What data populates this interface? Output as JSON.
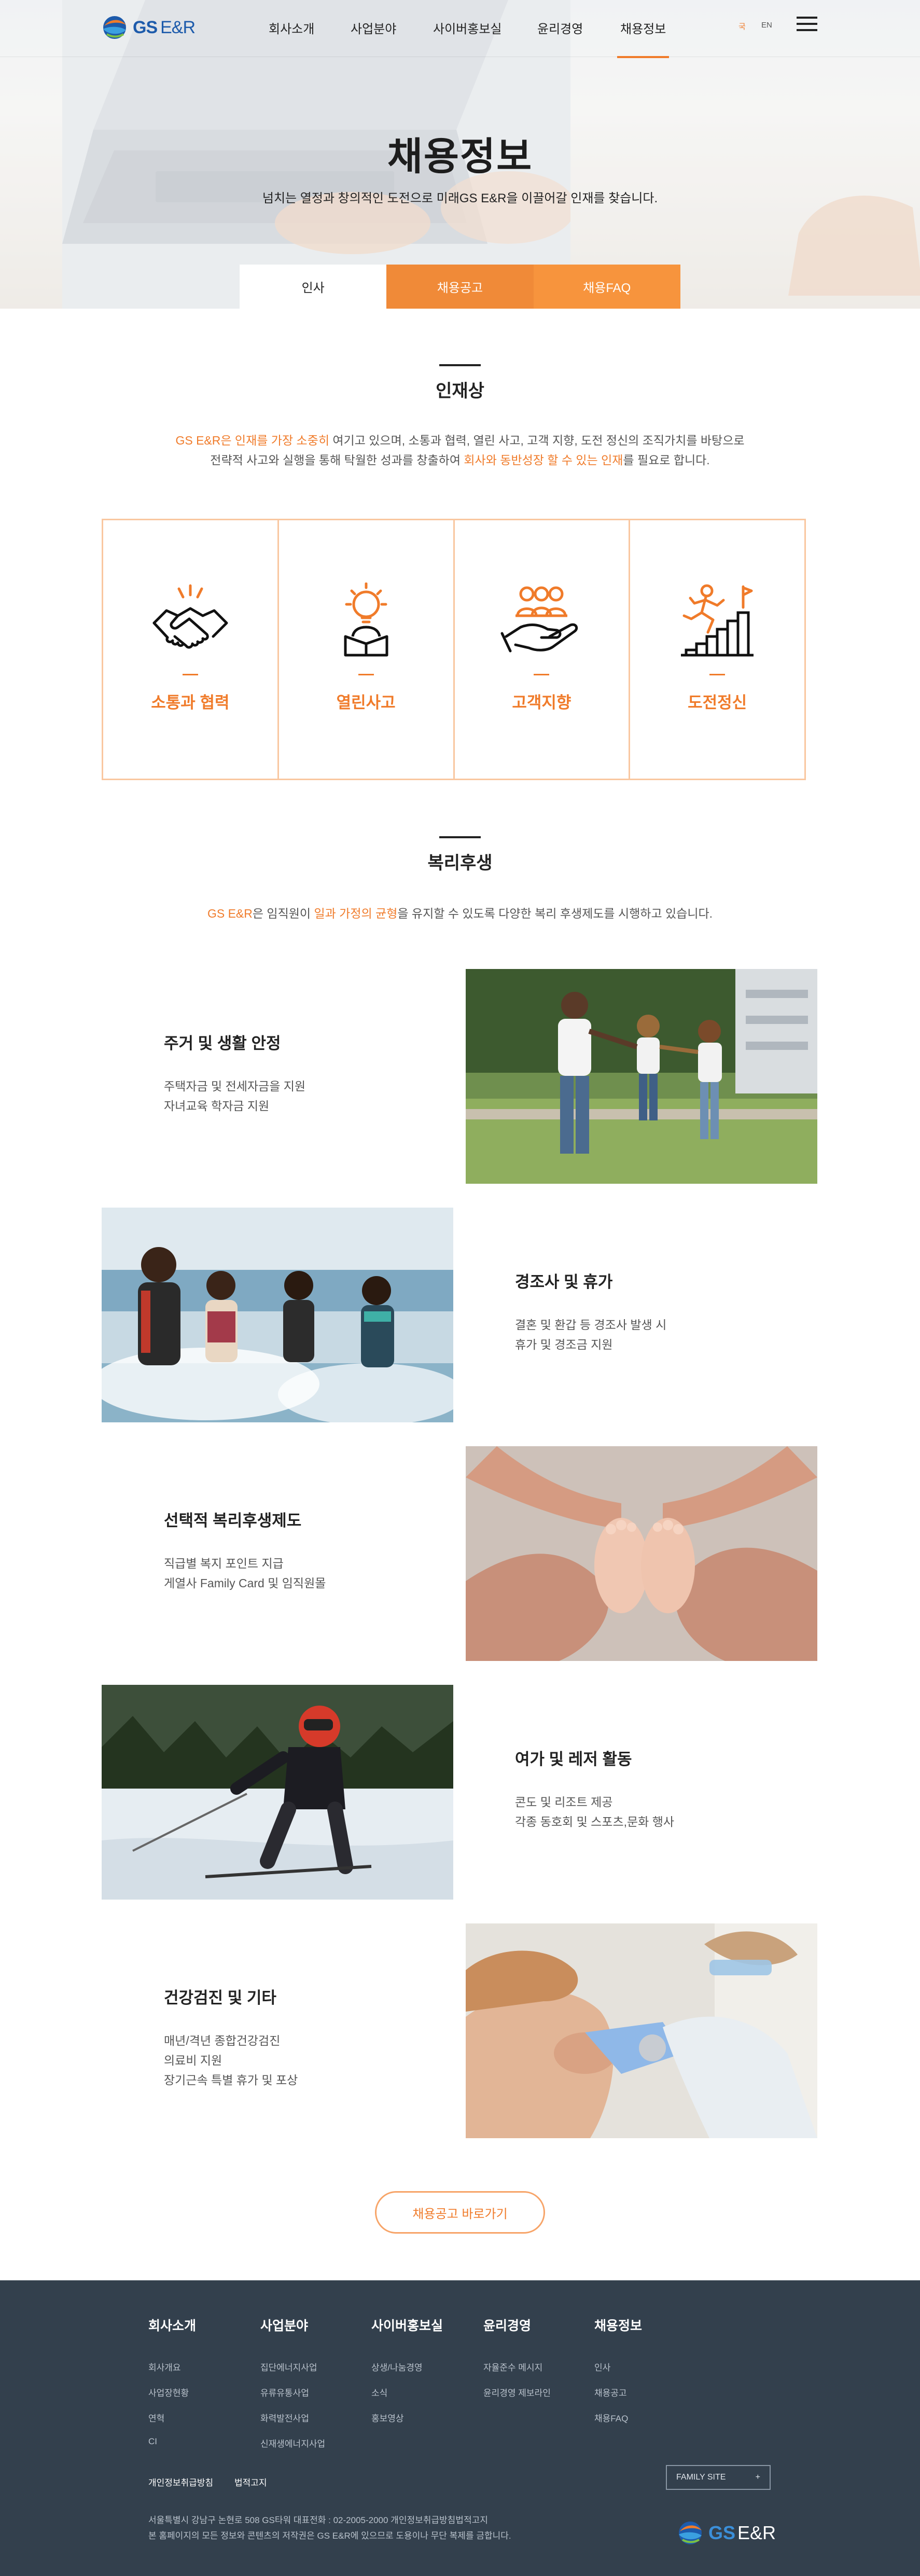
{
  "header": {
    "logo_gs": "GS",
    "logo_er": "E&R",
    "menu": [
      "회사소개",
      "사업분야",
      "사이버홍보실",
      "윤리경영",
      "채용정보"
    ],
    "active_menu": "채용정보",
    "lang_kr": "국",
    "lang_en": "EN"
  },
  "hero": {
    "title": "채용정보",
    "subtitle": "넘치는 열정과 창의적인 도전으로 미래GS E&R을 이끌어갈 인재를 찾습니다.",
    "tabs": [
      "인사",
      "채용공고",
      "채용FAQ"
    ],
    "active_tab": "인사"
  },
  "talent": {
    "title": "인재상",
    "desc_1a": "GS E&R은 인재를 가장 소중히",
    "desc_1b": " 여기고 있으며, 소통과 협력, 열린 사고, 고객 지향, 도전 정신의 조직가치를 바탕으로",
    "desc_2a": "전략적 사고와 실행을 통해 탁월한 성과를 창출하여 ",
    "desc_2b": "회사와 동반성장 할 수 있는 인재",
    "desc_2c": "를 필요로 합니다.",
    "items": [
      {
        "label": "소통과 협력",
        "icon": "handshake-icon"
      },
      {
        "label": "열린사고",
        "icon": "lightbulb-icon"
      },
      {
        "label": "고객지향",
        "icon": "customer-hand-icon"
      },
      {
        "label": "도전정신",
        "icon": "challenge-growth-icon"
      }
    ],
    "accent_color": "#f07b2a"
  },
  "welfare": {
    "title": "복리후생",
    "desc_a": "GS E&R",
    "desc_b": "은 임직원이 ",
    "desc_c": "일과 가정의 균형",
    "desc_d": "을 유지할 수 있도록 다양한 복리 후생제도를 시행하고 있습니다.",
    "items": [
      {
        "title": "주거 및 생활 안정",
        "lines": [
          "주택자금 및 전세자금을 지원",
          "자녀교육 학자금 지원"
        ],
        "image": "family-park-photo"
      },
      {
        "title": "경조사 및 휴가",
        "lines": [
          "결혼 및 환갑 등 경조사 발생 시",
          "휴가 및 경조금 지원"
        ],
        "image": "kids-pool-photo"
      },
      {
        "title": "선택적 복리후생제도",
        "lines": [
          "직급별 복지 포인트 지급",
          "게열사 Family Card 및 임직원몰"
        ],
        "image": "baby-feet-photo"
      },
      {
        "title": "여가 및 레저 활동",
        "lines": [
          "콘도 및 리조트 제공",
          "각종 동호회 및 스포츠,문화 행사"
        ],
        "image": "skier-photo"
      },
      {
        "title": "건강검진 및 기타",
        "lines": [
          "매년/격년 종합건강검진",
          "의료비 지원",
          "장기근속 특별 휴가 및 포상"
        ],
        "image": "dental-checkup-photo"
      }
    ]
  },
  "cta": {
    "label": "채용공고 바로가기"
  },
  "footer": {
    "columns": [
      {
        "head": "회사소개",
        "links": [
          "회사개요",
          "사업장현황",
          "연혁",
          "CI"
        ]
      },
      {
        "head": "사업분야",
        "links": [
          "집단에너지사업",
          "유류유통사업",
          "화력발전사업",
          "신재생에너지사업"
        ]
      },
      {
        "head": "사이버홍보실",
        "links": [
          "상생/나눔경영",
          "소식",
          "홍보영상"
        ]
      },
      {
        "head": "윤리경영",
        "links": [
          "자율준수 메시지",
          "윤리경영 제보라인"
        ]
      },
      {
        "head": "채용정보",
        "links": [
          "인사",
          "채용공고",
          "채용FAQ"
        ]
      }
    ],
    "legal": [
      "개인정보취급방침",
      "법적고지"
    ],
    "family_site": "FAMILY SITE",
    "family_plus": "+",
    "address_1": "서울특별시 강남구 논현로 508 GS타워   대표전화 : 02-2005-2000 개인정보취급방침법적고지",
    "address_2": "본 홈페이지의 모든 정보와 콘텐츠의 저작권은 GS E&R에 있으므로 도용이나 무단 복제를 금합니다.",
    "logo_gs": "GS",
    "logo_er": "E&R"
  }
}
